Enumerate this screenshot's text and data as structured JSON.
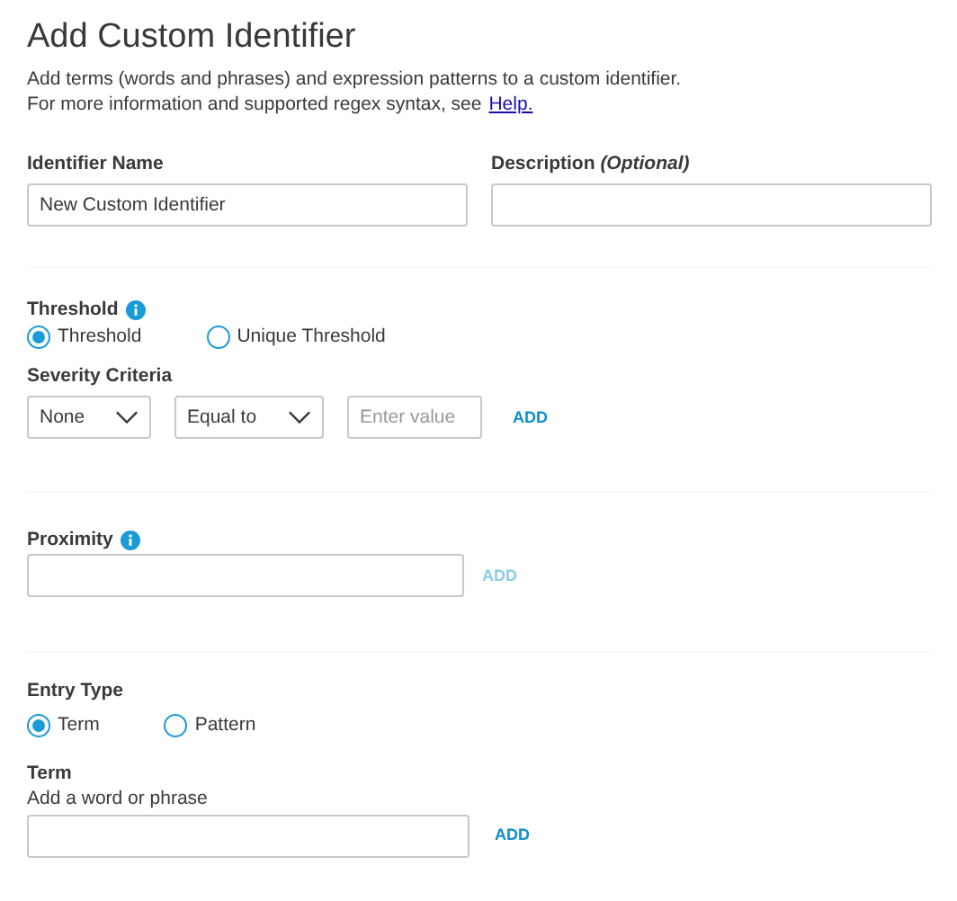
{
  "header": {
    "title": "Add Custom Identifier",
    "description": "Add terms (words and phrases) and expression patterns to a custom identifier.",
    "help_intro": "For more information and supported regex syntax, see",
    "help_link": "Help."
  },
  "identifier_name": {
    "label": "Identifier Name",
    "value": "New Custom Identifier"
  },
  "description": {
    "label": "Description *(Optional)*"
  },
  "threshold": {
    "label": "Threshold",
    "options": [
      {
        "label": "Threshold",
        "selected": true
      },
      {
        "label": "Unique Threshold",
        "selected": false
      }
    ]
  },
  "severity": {
    "label": "Severity Criteria",
    "level_select": "None",
    "operator_select": "Equal to",
    "value_placeholder": "Enter value",
    "add_button": {
      "label": "ADD",
      "disabled": false
    }
  },
  "proximity": {
    "label": "Proximity",
    "add_button": {
      "label": "ADD",
      "disabled": true
    }
  },
  "entry_type": {
    "label": "Entry Type",
    "options": [
      {
        "label": "Term",
        "selected": true
      },
      {
        "label": "Pattern",
        "selected": false
      }
    ]
  },
  "term": {
    "label": "Term",
    "hint": "Add a word or phrase",
    "add_button": {
      "label": "ADD",
      "disabled": false
    }
  }
}
